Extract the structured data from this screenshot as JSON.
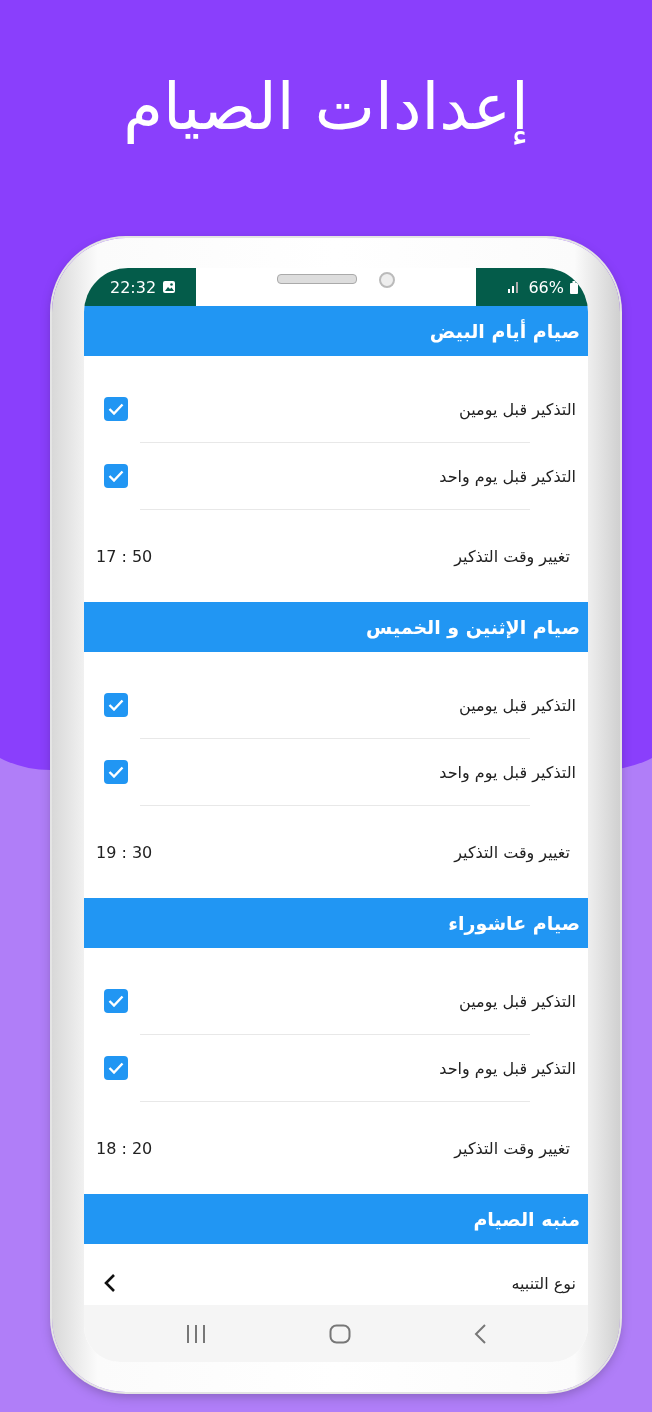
{
  "title": "إعدادات الصيام",
  "status_bar": {
    "time": "22:32",
    "battery": "66%"
  },
  "sections": [
    {
      "title": "صيام أيام البيض",
      "items": [
        {
          "kind": "checkbox",
          "label": "التذكير قبل يومين",
          "checked": true
        },
        {
          "kind": "checkbox",
          "label": "التذكير قبل يوم واحد",
          "checked": true
        },
        {
          "kind": "time",
          "label": "تغيير وقت التذكير",
          "time": "17 : 50"
        }
      ]
    },
    {
      "title": "صيام الإثنين و الخميس",
      "items": [
        {
          "kind": "checkbox",
          "label": "التذكير قبل يومين",
          "checked": true
        },
        {
          "kind": "checkbox",
          "label": "التذكير قبل يوم واحد",
          "checked": true
        },
        {
          "kind": "time",
          "label": "تغيير وقت التذكير",
          "time": "19 : 30"
        }
      ]
    },
    {
      "title": "صيام عاشوراء",
      "items": [
        {
          "kind": "checkbox",
          "label": "التذكير قبل يومين",
          "checked": true
        },
        {
          "kind": "checkbox",
          "label": "التذكير قبل يوم واحد",
          "checked": true
        },
        {
          "kind": "time",
          "label": "تغيير وقت التذكير",
          "time": "18 : 20"
        }
      ]
    },
    {
      "title": "منبه الصيام",
      "items": [
        {
          "kind": "link",
          "label": "نوع التنبيه"
        }
      ]
    }
  ]
}
